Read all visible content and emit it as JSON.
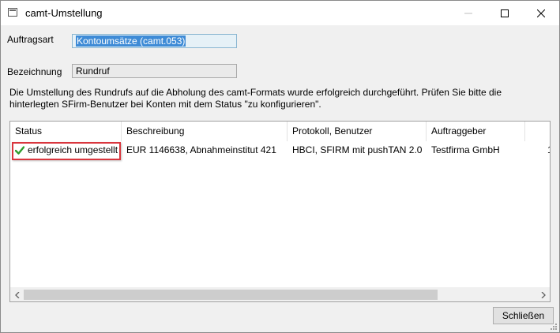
{
  "window": {
    "title": "camt-Umstellung"
  },
  "form": {
    "auftragsart_label": "Auftragsart",
    "auftragsart_value": "Kontoumsätze (camt.053)",
    "bezeichnung_label": "Bezeichnung",
    "bezeichnung_value": "Rundruf"
  },
  "info_text": {
    "line1": "Die Umstellung des Rundrufs auf die Abholung des camt-Formats wurde erfolgreich durchgeführt. Prüfen Sie bitte die",
    "line2": "hinterlegten SFirm-Benutzer bei Konten mit dem Status \"zu konfigurieren\"."
  },
  "table": {
    "columns": [
      "Status",
      "Beschreibung",
      "Protokoll, Benutzer",
      "Auftraggeber"
    ],
    "rows": [
      {
        "status": "erfolgreich umgestellt",
        "status_icon": "checkmark-icon",
        "beschreibung": "EUR 1146638, Abnahmeinstitut 421",
        "protokoll": "HBCI, SFIRM mit pushTAN 2.0",
        "auftraggeber": "Testfirma GmbH",
        "extra": "1"
      }
    ]
  },
  "buttons": {
    "close_label": "Schließen"
  },
  "colors": {
    "highlight_border": "#d9363e",
    "check_green": "#2e9e2e",
    "selection_blue": "#3e8bd6"
  }
}
